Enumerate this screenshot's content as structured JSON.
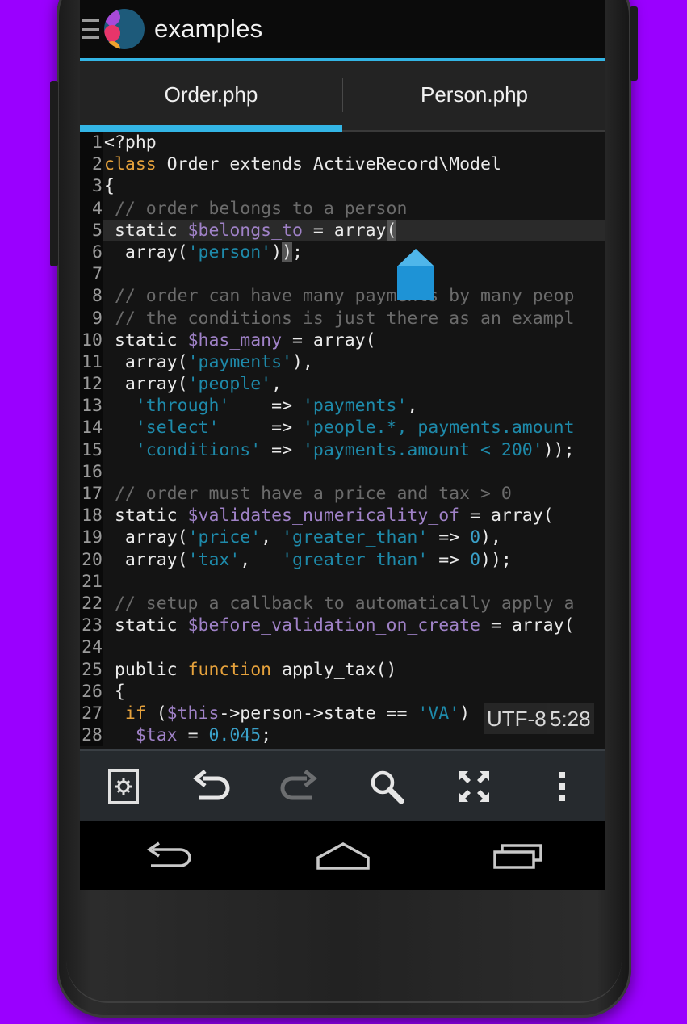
{
  "app": {
    "title": "examples"
  },
  "tabs": [
    {
      "label": "Order.php",
      "active": true
    },
    {
      "label": "Person.php",
      "active": false
    }
  ],
  "editor": {
    "lines": [
      {
        "n": "1",
        "html": "&lt;?php"
      },
      {
        "n": "2",
        "html": "<span class=\"kw\">class</span> Order extends ActiveRecord\\Model"
      },
      {
        "n": "3",
        "html": "{"
      },
      {
        "n": "4",
        "html": " <span class=\"cm\">// order belongs to a person</span>"
      },
      {
        "n": "5",
        "html": " static <span class=\"var\">$belongs_to</span> = array<span class=\"bracket\">(</span>",
        "current": true
      },
      {
        "n": "6",
        "html": "  array(<span class=\"str\">'person'</span>)<span class=\"bracket\">)</span>;"
      },
      {
        "n": "7",
        "html": ""
      },
      {
        "n": "8",
        "html": " <span class=\"cm\">// order can have many payments by many peop</span>"
      },
      {
        "n": "9",
        "html": " <span class=\"cm\">// the conditions is just there as an exampl</span>"
      },
      {
        "n": "10",
        "html": " static <span class=\"var\">$has_many</span> = array("
      },
      {
        "n": "11",
        "html": "  array(<span class=\"str\">'payments'</span>),"
      },
      {
        "n": "12",
        "html": "  array(<span class=\"str\">'people'</span>,"
      },
      {
        "n": "13",
        "html": "   <span class=\"str\">'through'</span>    =&gt; <span class=\"str\">'payments'</span>,"
      },
      {
        "n": "14",
        "html": "   <span class=\"str\">'select'</span>     =&gt; <span class=\"str\">'people.*, payments.amount</span>"
      },
      {
        "n": "15",
        "html": "   <span class=\"str\">'conditions'</span> =&gt; <span class=\"str\">'payments.amount &lt; 200'</span>));"
      },
      {
        "n": "16",
        "html": ""
      },
      {
        "n": "17",
        "html": " <span class=\"cm\">// order must have a price and tax &gt; 0</span>"
      },
      {
        "n": "18",
        "html": " static <span class=\"var\">$validates_numericality_of</span> = array("
      },
      {
        "n": "19",
        "html": "  array(<span class=\"str\">'price'</span>, <span class=\"str\">'greater_than'</span> =&gt; <span class=\"num\">0</span>),"
      },
      {
        "n": "20",
        "html": "  array(<span class=\"str\">'tax'</span>,   <span class=\"str\">'greater_than'</span> =&gt; <span class=\"num\">0</span>));"
      },
      {
        "n": "21",
        "html": ""
      },
      {
        "n": "22",
        "html": " <span class=\"cm\">// setup a callback to automatically apply a</span>"
      },
      {
        "n": "23",
        "html": " static <span class=\"var\">$before_validation_on_create</span> = array("
      },
      {
        "n": "24",
        "html": ""
      },
      {
        "n": "25",
        "html": " public <span class=\"kw\">function</span> apply_tax()"
      },
      {
        "n": "26",
        "html": " {"
      },
      {
        "n": "27",
        "html": "  <span class=\"kw\">if</span> (<span class=\"var\">$this</span>-&gt;person-&gt;state == <span class=\"str\">'VA'</span>)"
      },
      {
        "n": "28",
        "html": "   <span class=\"var\">$tax</span> = <span class=\"num\">0.045</span>;"
      }
    ]
  },
  "status": {
    "encoding": "UTF-8",
    "position": "5:28"
  },
  "toolbar": {
    "items": [
      "settings-icon",
      "undo-icon",
      "redo-icon",
      "search-icon",
      "fullscreen-icon",
      "overflow-menu-icon"
    ]
  },
  "navbar": {
    "items": [
      "back-icon",
      "home-icon",
      "recents-icon"
    ]
  },
  "colors": {
    "accent": "#33b5e5",
    "background": "#9a00ff",
    "keyword": "#e6a23c",
    "variable": "#a082c8",
    "string": "#1e8aaa",
    "comment": "#6b6b6b"
  }
}
